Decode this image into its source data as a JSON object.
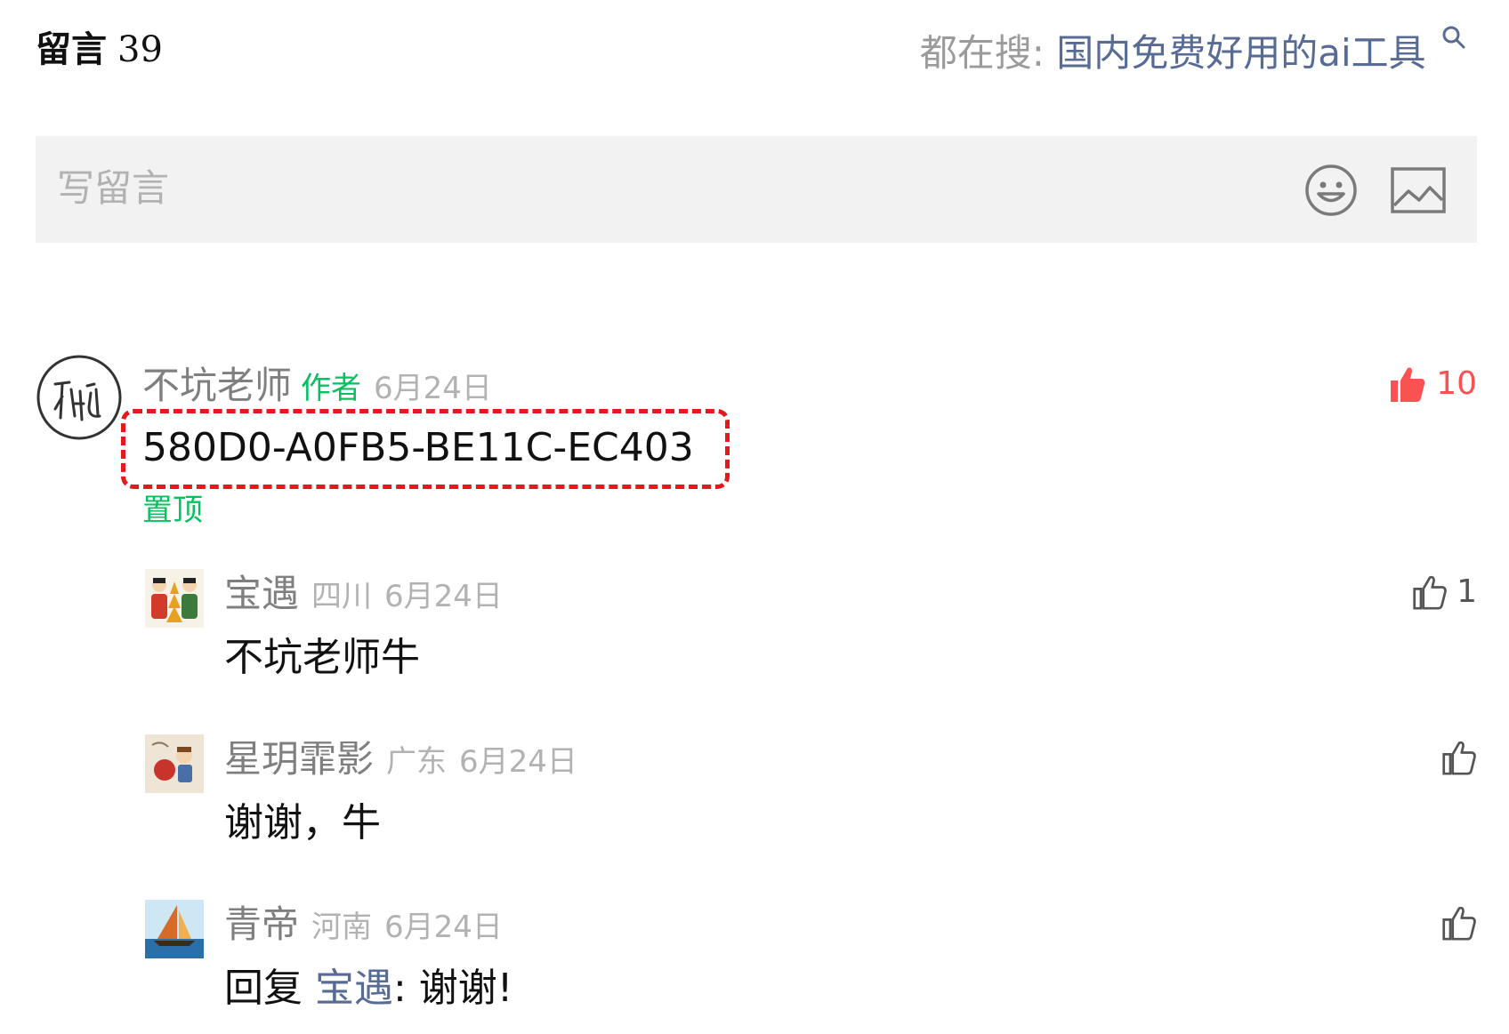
{
  "header": {
    "comments_label": "留言",
    "comments_count": "39",
    "search_prefix": "都在搜:",
    "search_term": "国内免费好用的ai工具"
  },
  "input": {
    "placeholder": "写留言"
  },
  "pinned_comment": {
    "nickname": "不坑老师",
    "author_tag": "作者",
    "date": "6月24日",
    "content": "580D0-A0FB5-BE11C-EC403",
    "pinned_label": "置顶",
    "likes": "10",
    "liked": true
  },
  "replies": [
    {
      "nickname": "宝遇",
      "location": "四川",
      "date": "6月24日",
      "content": "不坑老师牛",
      "likes": "1"
    },
    {
      "nickname": "星玥霏影",
      "location": "广东",
      "date": "6月24日",
      "content": "谢谢，牛",
      "likes": ""
    },
    {
      "nickname": "青帝",
      "location": "河南",
      "date": "6月24日",
      "reply_prefix": "回复",
      "reply_to": "宝遇",
      "reply_text": ": 谢谢!",
      "likes": ""
    }
  ],
  "colors": {
    "accent_green": "#07c160",
    "like_red": "#fa5151",
    "link_blue": "#576b95",
    "muted_gray": "#b2b2b2",
    "highlight_red": "#e5181d"
  },
  "icons": [
    "search-icon",
    "emoji-icon",
    "image-icon",
    "thumbs-up-icon"
  ]
}
